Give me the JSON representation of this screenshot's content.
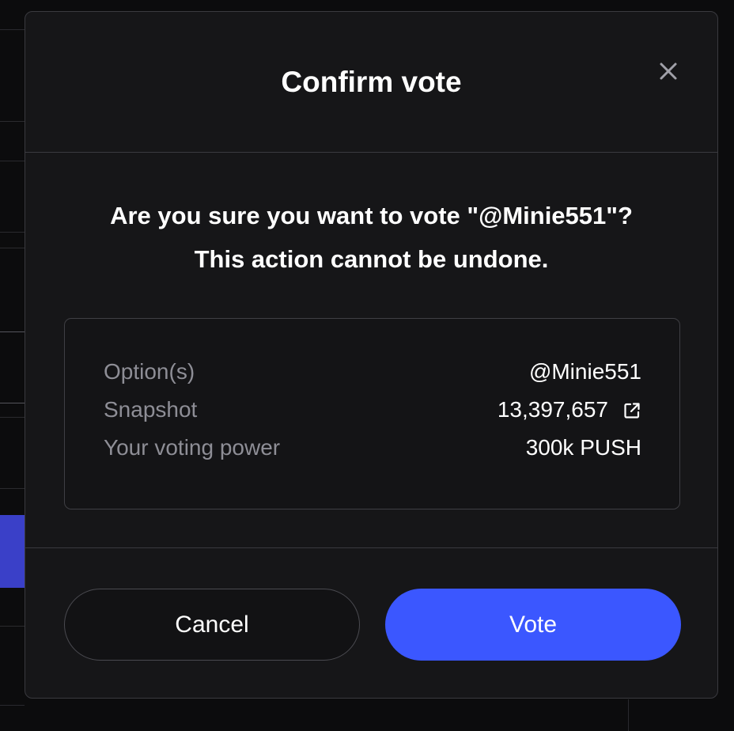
{
  "modal": {
    "title": "Confirm vote",
    "close_icon": "close-icon",
    "confirm_line1": "Are you sure you want to vote \"@Minie551\"?",
    "confirm_line2": "This action cannot be undone.",
    "details": {
      "option_label": "Option(s)",
      "option_value": "@Minie551",
      "snapshot_label": "Snapshot",
      "snapshot_value": "13,397,657",
      "snapshot_icon": "external-link-icon",
      "power_label": "Your voting power",
      "power_value": "300k PUSH"
    },
    "cancel_label": "Cancel",
    "vote_label": "Vote"
  },
  "colors": {
    "modal_bg": "#161618",
    "vote_button": "#3b57ff",
    "label_gray": "#8e8e96"
  }
}
